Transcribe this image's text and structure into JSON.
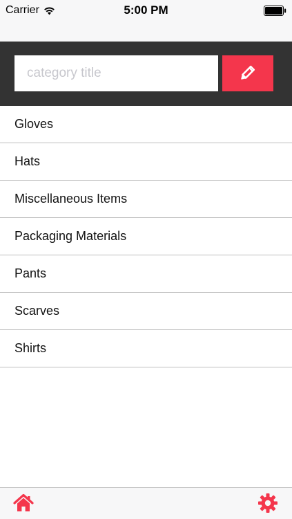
{
  "status_bar": {
    "carrier": "Carrier",
    "time": "5:00 PM"
  },
  "edit_bar": {
    "title_placeholder": "category title",
    "title_value": "",
    "edit_icon": "pencil-icon"
  },
  "categories": [
    {
      "label": "Gloves"
    },
    {
      "label": "Hats"
    },
    {
      "label": "Miscellaneous Items"
    },
    {
      "label": "Packaging Materials"
    },
    {
      "label": "Pants"
    },
    {
      "label": "Scarves"
    },
    {
      "label": "Shirts"
    }
  ],
  "toolbar": {
    "home_icon": "home-icon",
    "settings_icon": "gear-icon"
  },
  "colors": {
    "accent": "#f4364c",
    "header_bg": "#333333"
  }
}
